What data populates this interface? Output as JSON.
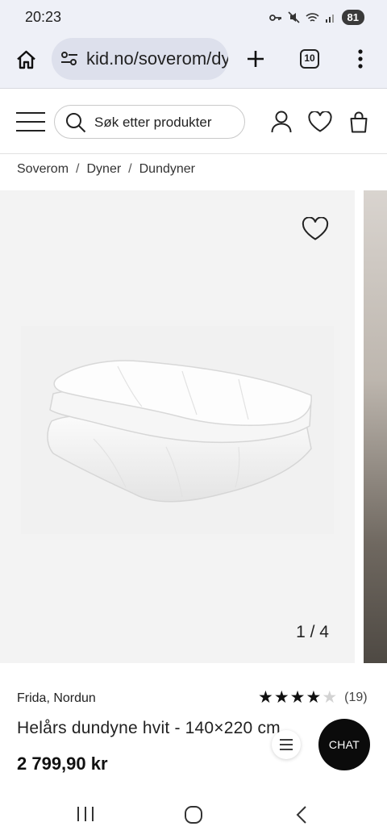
{
  "status": {
    "time": "20:23",
    "battery": "81"
  },
  "browser": {
    "url": "kid.no/soverom/dy",
    "tab_count": "10"
  },
  "header": {
    "search_placeholder": "Søk etter produkter"
  },
  "breadcrumb": [
    "Soverom",
    "Dyner",
    "Dundyner"
  ],
  "gallery": {
    "counter": "1 / 4"
  },
  "product": {
    "brand": "Frida, Nordun",
    "name": "Helårs dundyne hvit - 140×220 cm",
    "price": "2 799,90 kr",
    "rating": 4,
    "rating_max": 5,
    "review_count": "(19)"
  },
  "chat_label": "CHAT",
  "icons": [
    "home-icon",
    "site-settings-icon",
    "new-tab-icon",
    "tab-switcher-icon",
    "more-menu-icon",
    "hamburger-menu-icon",
    "search-icon",
    "account-icon",
    "wishlist-icon",
    "bag-icon",
    "favorite-heart-icon",
    "star-icon",
    "menu-lines-icon",
    "recent-apps-icon",
    "home-nav-icon",
    "back-nav-icon"
  ],
  "colors": {
    "browser_chrome": "#eef0f7",
    "url_box": "#dde0ec",
    "chat_button": "#0b0b0b",
    "star": "#111111"
  }
}
